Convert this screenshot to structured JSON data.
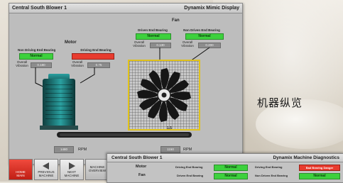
{
  "window": {
    "title_left": "Central South Blower 1",
    "title_right": "Dynamix Mimic Display"
  },
  "motor": {
    "label": "Motor",
    "nde": {
      "title": "Non Driving End Bearing",
      "status": "Normal",
      "vib_label": "Overall\nVibration",
      "value": "0.180"
    },
    "de": {
      "title": "Driving End Bearing",
      "status": "",
      "vib_label": "Overall\nVibration",
      "value": "0.75"
    },
    "rpm_value": "1480",
    "rpm_unit": "RPM"
  },
  "fan": {
    "label": "Fan",
    "de": {
      "title": "Driven End Bearing",
      "status": "Normal",
      "vib_label": "Overall\nVibration",
      "value": "0.130"
    },
    "nde": {
      "title": "Non Driven End Bearing",
      "status": "Normal",
      "vib_label": "Overall\nVibration",
      "value": "0.200"
    },
    "shaft_label": "1.5",
    "rpm_value": "1150",
    "rpm_unit": "RPM"
  },
  "nav": {
    "buttons": [
      {
        "label": "HOME\nMAIN"
      },
      {
        "label": "PREVIOUS\nMACHINE"
      },
      {
        "label": "NEXT\nMACHINE"
      },
      {
        "label": "MACHINE\nOVERVIEW"
      }
    ]
  },
  "diagnostics": {
    "title_left": "Central South Blower 1",
    "title_right": "Dynamix Machine Diagnostics",
    "rows": [
      {
        "name": "Motor",
        "a_label": "Driving End Bearing",
        "a_status": "Normal",
        "b_label": "Driving End Bearing",
        "b_status": "Normal",
        "c_status": "Bad Bearing Danger"
      },
      {
        "name": "Fan",
        "a_label": "Driven End Bearing",
        "a_status": "Normal",
        "b_label": "Non Driven End Bearing",
        "b_status": "Normal"
      }
    ]
  },
  "caption": "机器纵览",
  "colors": {
    "normal": "#3dd13d",
    "alarm": "#e83b2e",
    "fan_frame": "#e0c21b",
    "motor": "#1e7a7a"
  }
}
